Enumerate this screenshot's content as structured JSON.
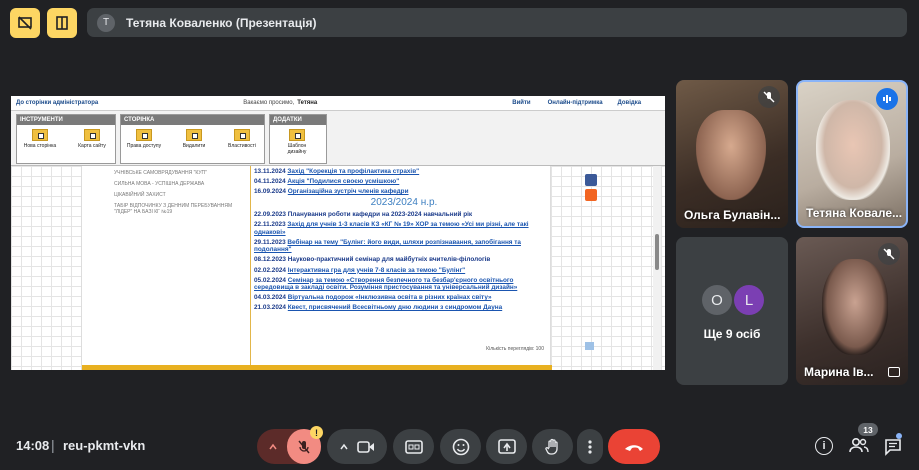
{
  "top": {
    "presenter_initial": "T",
    "presenter_label": "Тетяна Коваленко (Презентація)"
  },
  "presentation": {
    "admin_bar": {
      "link_admin": "До сторінки адміністратора",
      "greeting": "Вакаємо просимо,",
      "user": "Тетяна",
      "exit": "Вийти",
      "support": "Онлайн-підтримка",
      "help": "Довідка"
    },
    "groups": [
      {
        "title": "ІНСТРУМЕНТИ",
        "tools": [
          "Нова сторінка",
          "Карта сайту"
        ]
      },
      {
        "title": "СТОРІНКА",
        "tools": [
          "Права доступу",
          "Видалити",
          "Властивості"
        ]
      },
      {
        "title": "ДОДАТКИ",
        "tools": [
          "Шаблон дизайну"
        ]
      }
    ],
    "left_links": [
      "УЧНІВСЬКЕ САМОВРЯДУВАННЯ \"КУП\"",
      "СИЛЬНА МОВА - УСПІШНА ДЕРЖАВА",
      "ЦІКАВІЙНИЙ ЗАХИСТ",
      "ТАБІР ВІДПОЧИНКУ З ДЕННИМ ПЕРЕБУВАННЯМ \"ЛІДЕР\" НА БАЗІ КГ №19"
    ],
    "news_top": [
      {
        "date": "13.11.2024",
        "text": "Захід \"Корекція та профілактика страхів\""
      },
      {
        "date": "04.11.2024",
        "text": "Акція \"Подилися своєю усмішкою\""
      },
      {
        "date": "16.09.2024",
        "text": "Організаційна зустріч членів кафедри"
      }
    ],
    "year_header": "2023/2024 н.р.",
    "news_bottom": [
      {
        "date": "22.09.2023",
        "text": "Планування роботи кафедри на 2023-2024 навчальний рік"
      },
      {
        "date": "22.11.2023",
        "text": "Захід для учнів 1-3 класів КЗ «КГ № 19» ХОР за темою «Усі ми різні, але такі однакові»"
      },
      {
        "date": "29.11.2023",
        "text": "Вебінар на тему \"Булінг: його види, шляхи розпізнавання, запобігання та подолання\""
      },
      {
        "date": "08.12.2023",
        "text": "Науково-практичний семінар для майбутніх вчителів-філологів"
      },
      {
        "date": "02.02.2024",
        "text": "Інтерактивна гра для учнів 7-8 класів за темою \"Булінг\""
      },
      {
        "date": "05.02.2024",
        "text": "Семінар за темою «Створення безпечного та безбар'єрного освітнього середовища в закладі освіти. Розуміння пристосування та універсальний дизайн»"
      },
      {
        "date": "04.03.2024",
        "text": "Віртуальна подорож «Інклюзивна освіта в різних країнах світу»"
      },
      {
        "date": "21.03.2024",
        "text": "Квест, присвячений Всесвітньому дню людини з синдромом Дауна"
      }
    ],
    "counter": "Кількість переглядів: 100"
  },
  "tiles": {
    "t1": {
      "name": "Ольга Булавін..."
    },
    "t2": {
      "name": "Тетяна Ковале..."
    },
    "t3": {
      "avatar1": "O",
      "avatar2": "L",
      "label": "Ще 9 осіб"
    },
    "t4": {
      "name": "Марина Ів..."
    }
  },
  "bottom": {
    "time": "14:08",
    "separator": "|",
    "meeting_code": "reu-pkmt-vkn",
    "participants_count": "13",
    "warning_badge": "!"
  },
  "colors": {
    "background": "#202124",
    "yellow": "#fdd663",
    "end_call": "#ea4335",
    "mic_off_bg": "#f28b82",
    "avatar_o": "#5f6368",
    "avatar_l": "#7b3fb3"
  }
}
